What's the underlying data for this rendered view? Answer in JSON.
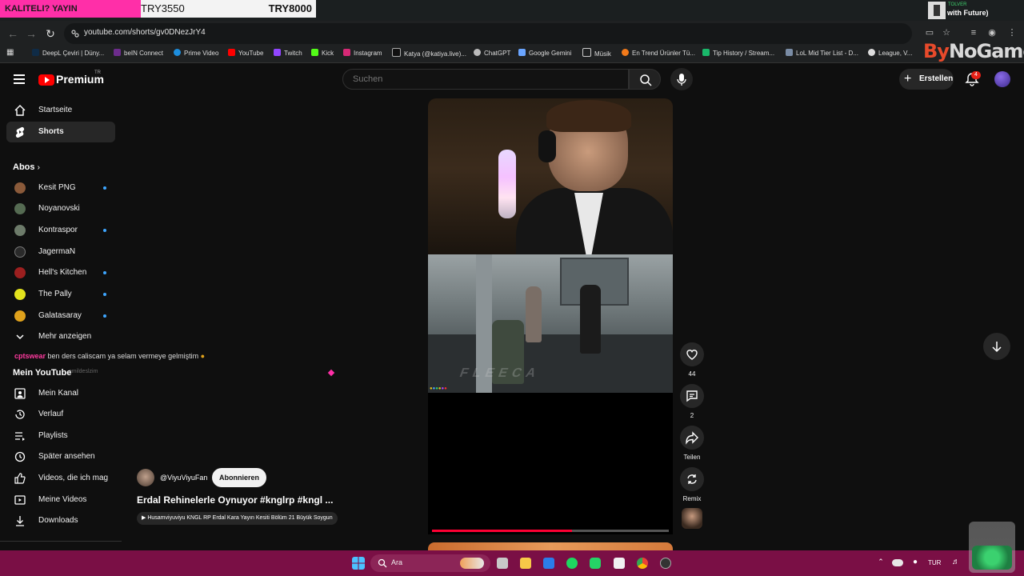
{
  "overlay": {
    "banner_left": "KALITELI? YAYIN",
    "price_left": "TRY3550",
    "price_right": "TRY8000",
    "now_playing_artist": "TOLVER",
    "now_playing_title": "with Future)"
  },
  "browser": {
    "url": "youtube.com/shorts/gv0DNezJrY4",
    "bookmarks": [
      "DeepL Çeviri | Düny...",
      "beIN Connect",
      "Prime Video",
      "YouTube",
      "Twitch",
      "Kick",
      "Instagram",
      "Katya (@katiya.live)...",
      "ChatGPT",
      "Google Gemini",
      "Müsik",
      "En Trend Ürünler Tü...",
      "Tip History / Stream...",
      "LoL Mid Tier List - D...",
      "League, V..."
    ],
    "watermark_a": "By",
    "watermark_b": "NoGame"
  },
  "header": {
    "logo_text": "Premium",
    "logo_region": "TR",
    "search_placeholder": "Suchen",
    "create_label": "Erstellen",
    "notification_count": "4"
  },
  "sidebar": {
    "top": [
      "Startseite",
      "Shorts"
    ],
    "subs_title": "Abos",
    "subscriptions": [
      {
        "name": "Kesit PNG",
        "new": true,
        "color": "#8a5a3a"
      },
      {
        "name": "Noyanovski",
        "new": false,
        "color": "#556b52"
      },
      {
        "name": "Kontraspor",
        "new": true,
        "color": "#6d7b6a"
      },
      {
        "name": "JagermaN",
        "new": false,
        "color": "#2a2a2a"
      },
      {
        "name": "Hell's Kitchen",
        "new": true,
        "color": "#9c1f1f"
      },
      {
        "name": "The Pally",
        "new": true,
        "color": "#e3e31d"
      },
      {
        "name": "Galatasaray",
        "new": true,
        "color": "#e0a21c"
      }
    ],
    "show_more": "Mehr anzeigen",
    "my_youtube_title": "Mein YouTube",
    "my_youtube": [
      "Mein Kanal",
      "Verlauf",
      "Playlists",
      "Später ansehen",
      "Videos, die ich mag",
      "Meine Videos",
      "Downloads"
    ]
  },
  "chat_overlay": {
    "user": "cptswear",
    "message": "ben ders caliscam ya selam vermeye gelmiştim",
    "sub": "...emildeslzim"
  },
  "short": {
    "likes": "44",
    "comments": "2",
    "share_label": "Teilen",
    "remix_label": "Remix",
    "progress": 0.59,
    "channel": "@ViyuViyuFan",
    "subscribe_label": "Abonnieren",
    "title": "Erdal Rehinelerle Oynuyor #knglrp #kngl ...",
    "related": "Husamviyuviyu KNGL RP Erdal Kara Yayın Kesiti Bölüm 21 Büyük Soygun",
    "game_text": "FLEECA"
  },
  "taskbar": {
    "search_label": "Ara",
    "lang": "TUR"
  }
}
